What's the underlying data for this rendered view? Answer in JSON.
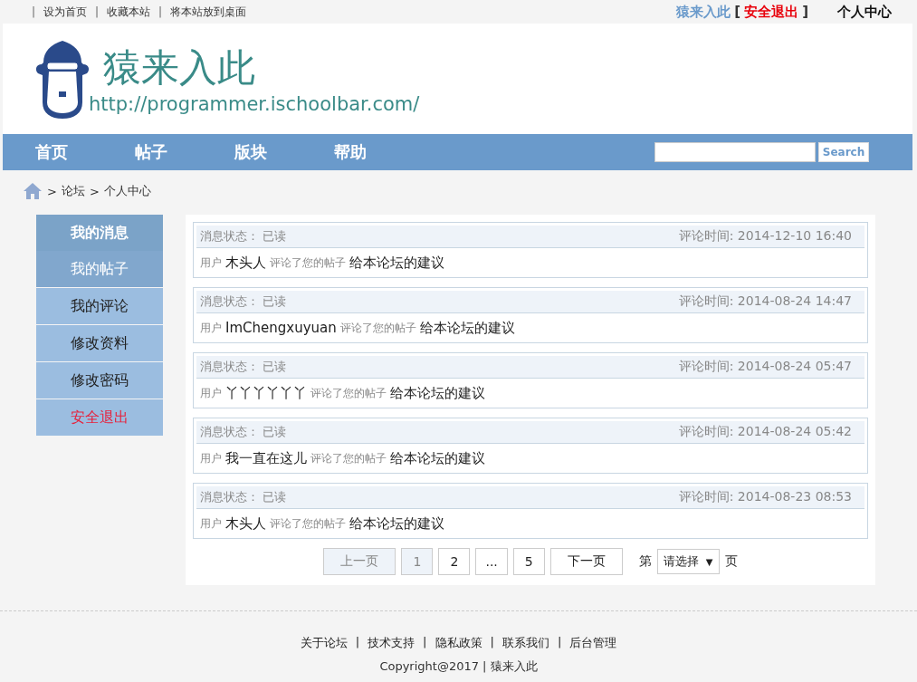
{
  "top_bar": {
    "separator": "|",
    "open_bracket": "[",
    "close_bracket": "]",
    "links": [
      "设为首页",
      "收藏本站",
      "将本站放到桌面"
    ],
    "user_name": "猿来入此",
    "logout": "安全退出",
    "personal_center": "个人中心"
  },
  "header": {
    "site_name": "猿来入此",
    "url": "http://programmer.ischoolbar.com/"
  },
  "nav": {
    "items": [
      "首页",
      "帖子",
      "版块",
      "帮助"
    ],
    "search_button": "Search"
  },
  "breadcrumb_separator": ">",
  "breadcrumb": [
    "论坛",
    "个人中心"
  ],
  "sidebar": {
    "title": "我的消息",
    "items": [
      {
        "label": "我的帖子",
        "selected": true,
        "kind": "link"
      },
      {
        "label": "我的评论",
        "selected": false,
        "kind": "link"
      },
      {
        "label": "修改资料",
        "selected": false,
        "kind": "link"
      },
      {
        "label": "修改密码",
        "selected": false,
        "kind": "link"
      },
      {
        "label": "安全退出",
        "selected": false,
        "kind": "logout"
      }
    ]
  },
  "messages": [
    {
      "status_label": "消息状态：",
      "status": "已读",
      "time": "评论时间: 2014-12-10 16:40",
      "user_label": "用户",
      "user": "木头人",
      "action": "评论了您的帖子",
      "post": "给本论坛的建议"
    },
    {
      "status_label": "消息状态：",
      "status": "已读",
      "time": "评论时间: 2014-08-24 14:47",
      "user_label": "用户",
      "user": "ImChengxuyuan",
      "action": "评论了您的帖子",
      "post": "给本论坛的建议"
    },
    {
      "status_label": "消息状态：",
      "status": "已读",
      "time": "评论时间: 2014-08-24 05:47",
      "user_label": "用户",
      "user": "丫丫丫丫丫丫",
      "action": "评论了您的帖子",
      "post": "给本论坛的建议"
    },
    {
      "status_label": "消息状态：",
      "status": "已读",
      "time": "评论时间: 2014-08-24 05:42",
      "user_label": "用户",
      "user": "我一直在这儿",
      "action": "评论了您的帖子",
      "post": "给本论坛的建议"
    },
    {
      "status_label": "消息状态：",
      "status": "已读",
      "time": "评论时间: 2014-08-23 08:53",
      "user_label": "用户",
      "user": "木头人",
      "action": "评论了您的帖子",
      "post": "给本论坛的建议"
    }
  ],
  "pagination": {
    "prev": {
      "label": "上一页",
      "disabled": true
    },
    "pages": [
      {
        "label": "1",
        "selected": true
      },
      {
        "label": "2",
        "selected": false
      },
      {
        "label": "...",
        "selected": false
      },
      {
        "label": "5",
        "selected": false
      }
    ],
    "next": {
      "label": "下一页",
      "disabled": false
    },
    "jump_prefix": "第",
    "jump_select": "请选择",
    "select_caret": "▼",
    "jump_suffix": "页"
  },
  "footer": {
    "separator": "|",
    "links": [
      "关于论坛",
      "技术支持",
      "隐私政策",
      "联系我们",
      "后台管理"
    ],
    "copyright": "Copyright@2017 | 猿来入此"
  }
}
